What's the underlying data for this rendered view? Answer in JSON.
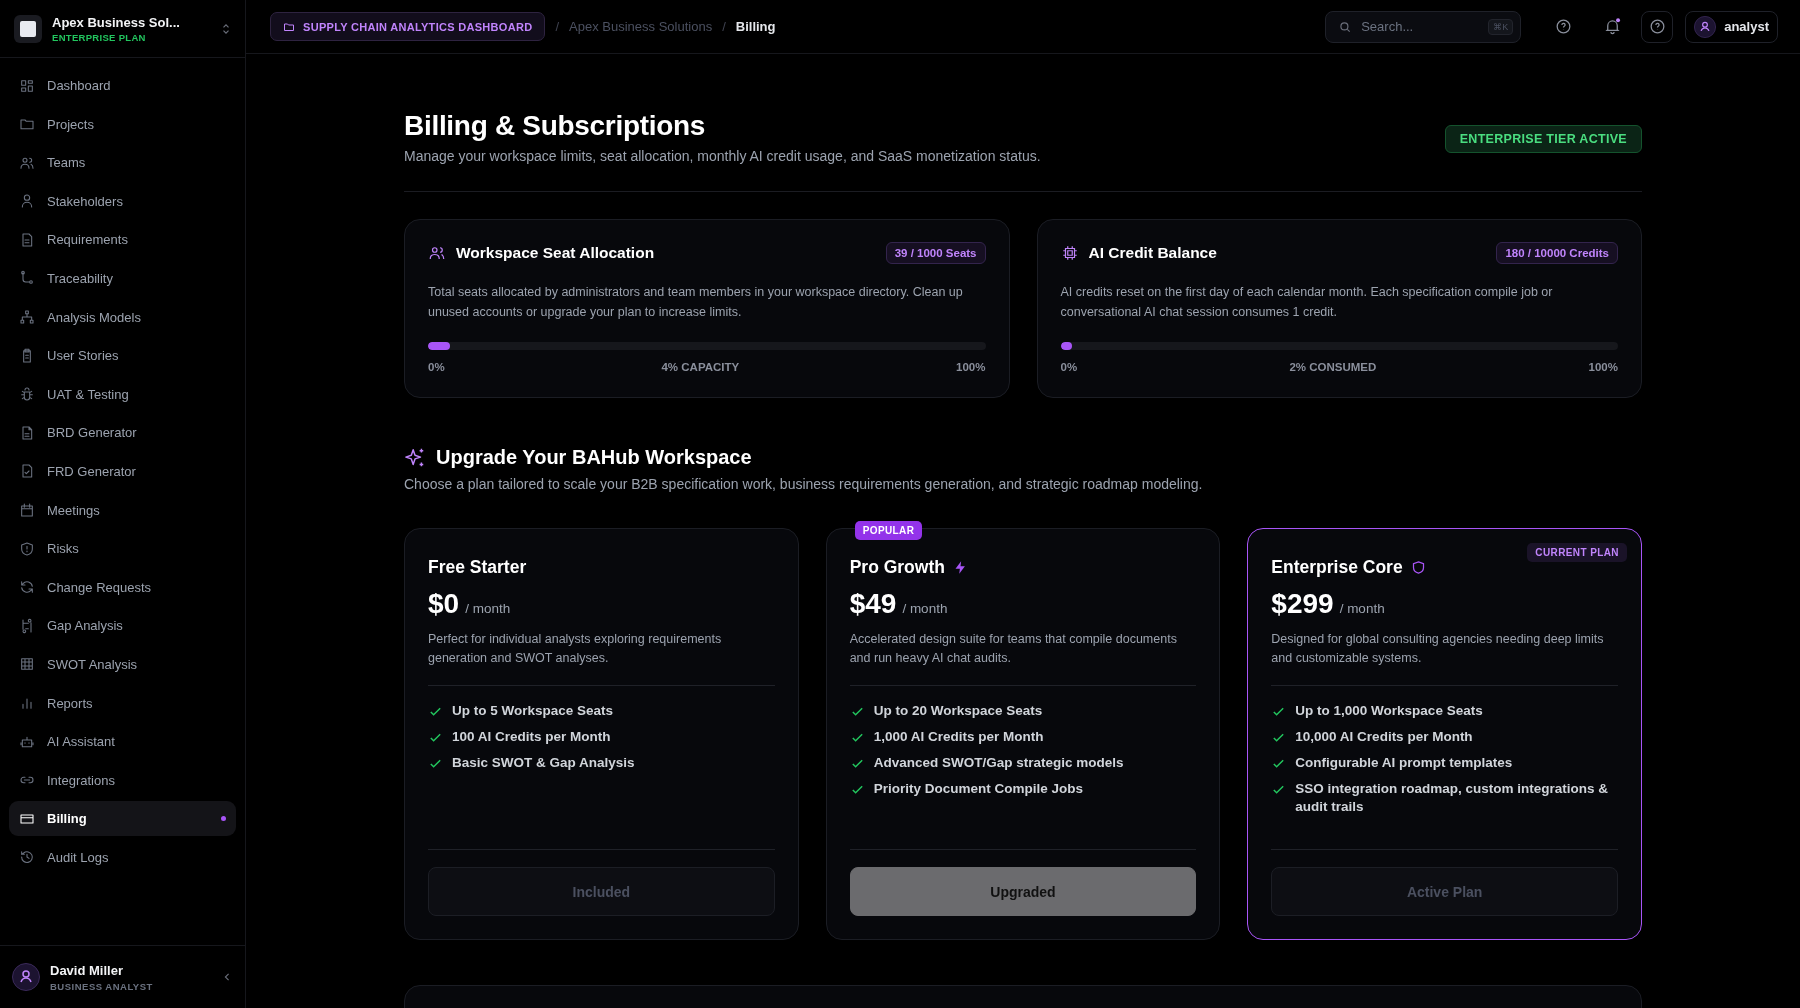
{
  "workspace": {
    "name": "Apex Business Sol...",
    "plan": "ENTERPRISE PLAN"
  },
  "topbar": {
    "project_chip": "SUPPLY CHAIN ANALYTICS DASHBOARD",
    "breadcrumb": [
      {
        "separator": "/",
        "label": "Apex Business Solutions"
      },
      {
        "separator": "/",
        "label": "Billing"
      }
    ],
    "search": {
      "placeholder": "Search...",
      "shortcut": "⌘K"
    },
    "notifications_unread": true,
    "user": "analyst"
  },
  "sidebar": {
    "items": [
      {
        "label": "Dashboard",
        "selected": false
      },
      {
        "label": "Projects",
        "selected": false
      },
      {
        "label": "Teams",
        "selected": false
      },
      {
        "label": "Stakeholders",
        "selected": false
      },
      {
        "label": "Requirements",
        "selected": false
      },
      {
        "label": "Traceability",
        "selected": false
      },
      {
        "label": "Analysis Models",
        "selected": false
      },
      {
        "label": "User Stories",
        "selected": false
      },
      {
        "label": "UAT & Testing",
        "selected": false
      },
      {
        "label": "BRD Generator",
        "selected": false
      },
      {
        "label": "FRD Generator",
        "selected": false
      },
      {
        "label": "Meetings",
        "selected": false
      },
      {
        "label": "Risks",
        "selected": false
      },
      {
        "label": "Change Requests",
        "selected": false
      },
      {
        "label": "Gap Analysis",
        "selected": false
      },
      {
        "label": "SWOT Analysis",
        "selected": false
      },
      {
        "label": "Reports",
        "selected": false
      },
      {
        "label": "AI Assistant",
        "selected": false
      },
      {
        "label": "Integrations",
        "selected": false
      },
      {
        "label": "Billing",
        "selected": true
      },
      {
        "label": "Audit Logs",
        "selected": false
      }
    ]
  },
  "profile": {
    "name": "David Miller",
    "role": "BUSINESS ANALYST"
  },
  "page": {
    "title": "Billing & Subscriptions",
    "subtitle": "Manage your workspace limits, seat allocation, monthly AI credit usage, and SaaS monetization status.",
    "status_badge": "ENTERPRISE TIER ACTIVE"
  },
  "usage_cards": [
    {
      "kind": "seats",
      "title": "Workspace Seat Allocation",
      "badge": "39 / 1000 Seats",
      "description": "Total seats allocated by administrators and team members in your workspace directory. Clean up unused accounts or upgrade your plan to increase limits.",
      "level": 0.04,
      "min": "0%",
      "reading": "4% CAPACITY",
      "max": "100%"
    },
    {
      "kind": "credits",
      "title": "AI Credit Balance",
      "badge": "180 / 10000 Credits",
      "description": "AI credits reset on the first day of each calendar month. Each specification compile job or conversational AI chat session consumes 1 credit.",
      "level": 0.02,
      "min": "0%",
      "reading": "2% CONSUMED",
      "max": "100%"
    }
  ],
  "upgrade": {
    "title": "Upgrade Your BAHub Workspace",
    "subtitle": "Choose a plan tailored to scale your B2B specification work, business requirements generation, and strategic roadmap modeling."
  },
  "plans": [
    {
      "kind": "free",
      "name": "Free Starter",
      "current": false,
      "price": "$0",
      "period": "/ month",
      "description": "Perfect for individual analysts exploring requirements generation and SWOT analyses.",
      "features": [
        "Up to 5 Workspace Seats",
        "100 AI Credits per Month",
        "Basic SWOT & Gap Analysis"
      ],
      "button": {
        "label": "Included",
        "kind": "muted"
      }
    },
    {
      "kind": "pro",
      "name": "Pro Growth",
      "badge": "POPULAR",
      "current": false,
      "price": "$49",
      "period": "/ month",
      "description": "Accelerated design suite for teams that compile documents and run heavy AI chat audits.",
      "features": [
        "Up to 20 Workspace Seats",
        "1,000 AI Credits per Month",
        "Advanced SWOT/Gap strategic models",
        "Priority Document Compile Jobs"
      ],
      "button": {
        "label": "Upgraded",
        "kind": "filled"
      }
    },
    {
      "kind": "enterprise",
      "name": "Enterprise Core",
      "badge": "CURRENT PLAN",
      "current": true,
      "price": "$299",
      "period": "/ month",
      "description": "Designed for global consulting agencies needing deep limits and customizable systems.",
      "features": [
        "Up to 1,000 Workspace Seats",
        "10,000 AI Credits per Month",
        "Configurable AI prompt templates",
        "SSO integration roadmap, custom integrations & audit trails"
      ],
      "button": {
        "label": "Active Plan",
        "kind": "muted"
      }
    }
  ]
}
